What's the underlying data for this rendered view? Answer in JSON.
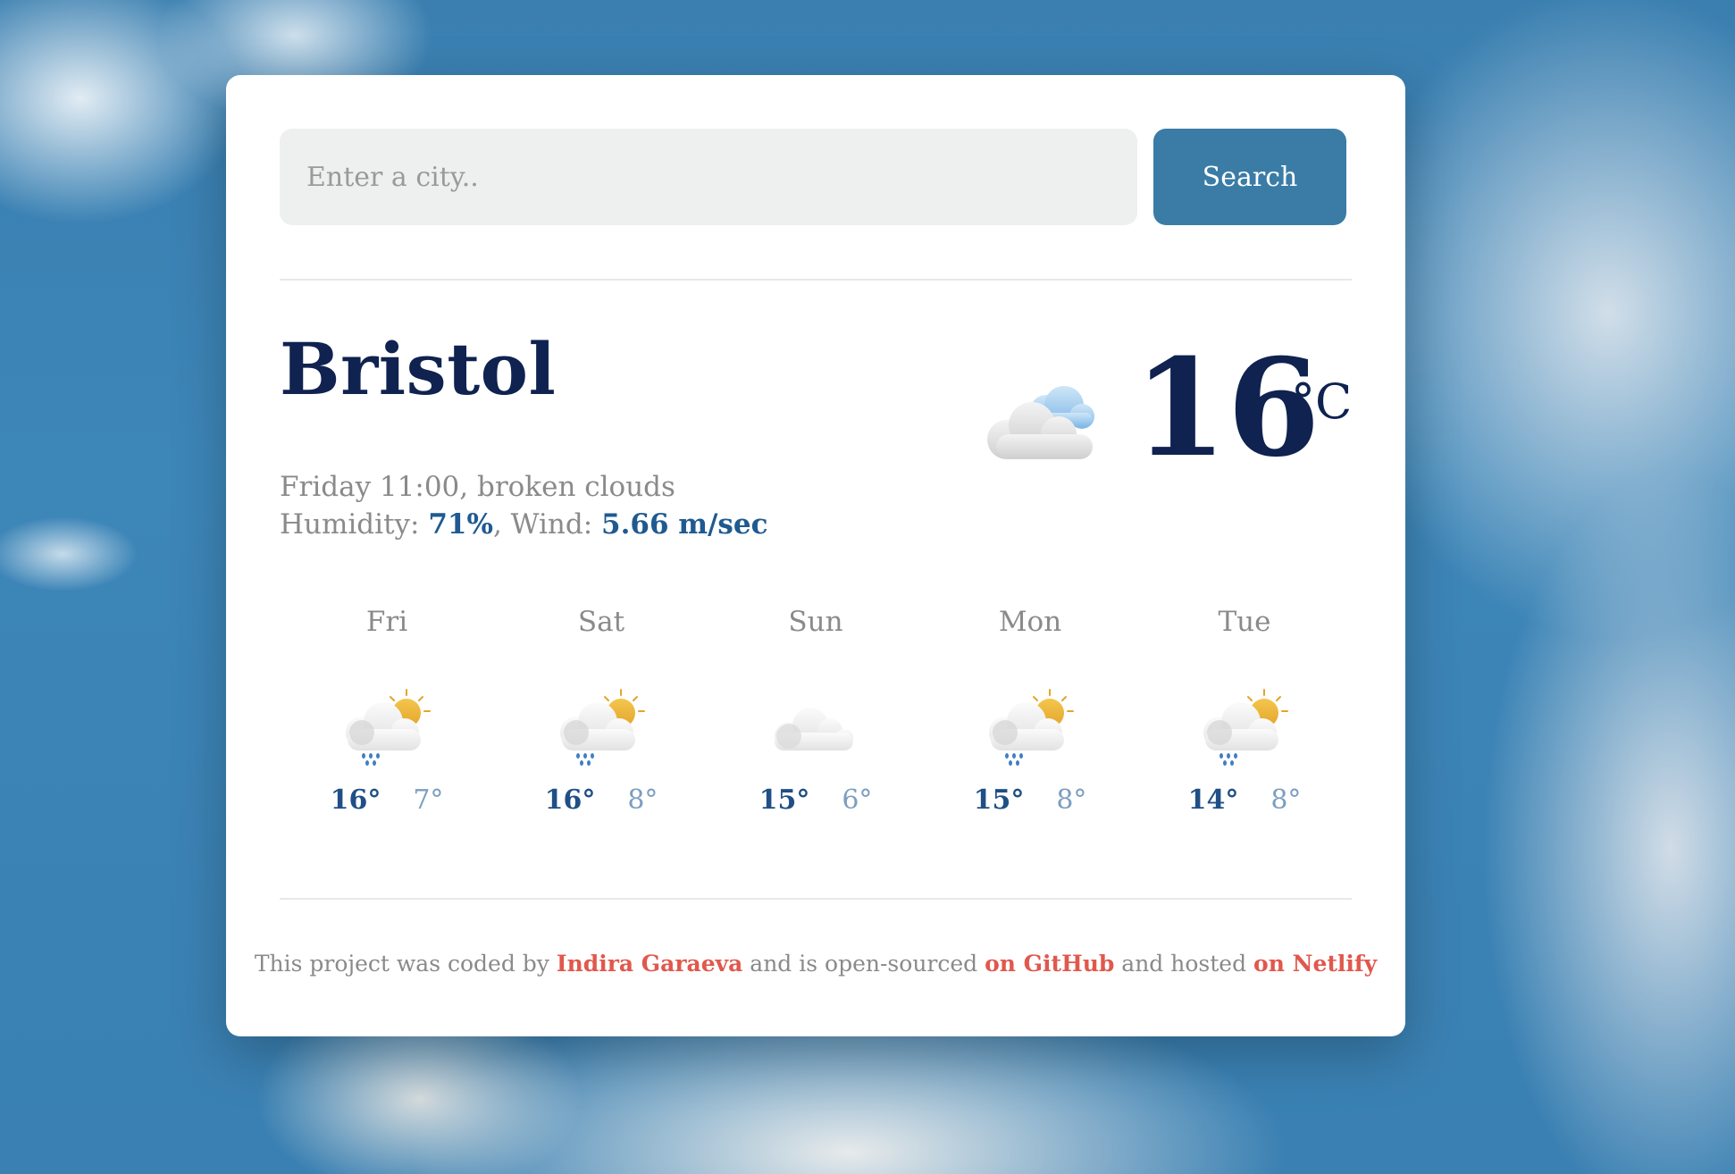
{
  "search": {
    "placeholder": "Enter a city..",
    "button_label": "Search"
  },
  "current": {
    "city": "Bristol",
    "datetime_desc": "Friday 11:00, broken clouds",
    "humidity_label": "Humidity: ",
    "humidity_value": "71%",
    "wind_label": ", Wind: ",
    "wind_value": "5.66 m/sec",
    "temperature": "16",
    "unit": "°C",
    "icon": "broken-clouds-icon"
  },
  "forecast": [
    {
      "day": "Fri",
      "max": "16°",
      "min": "7°",
      "icon": "sun-cloud-rain-icon"
    },
    {
      "day": "Sat",
      "max": "16°",
      "min": "8°",
      "icon": "sun-cloud-rain-icon"
    },
    {
      "day": "Sun",
      "max": "15°",
      "min": "6°",
      "icon": "cloud-icon"
    },
    {
      "day": "Mon",
      "max": "15°",
      "min": "8°",
      "icon": "sun-cloud-rain-icon"
    },
    {
      "day": "Tue",
      "max": "14°",
      "min": "8°",
      "icon": "sun-cloud-rain-icon"
    }
  ],
  "footer": {
    "text_1": "This project was coded by ",
    "author_link": "Indira Garaeva",
    "text_2": " and is open-sourced ",
    "github_link": "on GitHub",
    "text_3": " and hosted ",
    "netlify_link": "on Netlify"
  },
  "colors": {
    "accent": "#3a7ca6",
    "heading": "#0f2250",
    "highlight": "#1f5a90",
    "link": "#e0584d"
  }
}
